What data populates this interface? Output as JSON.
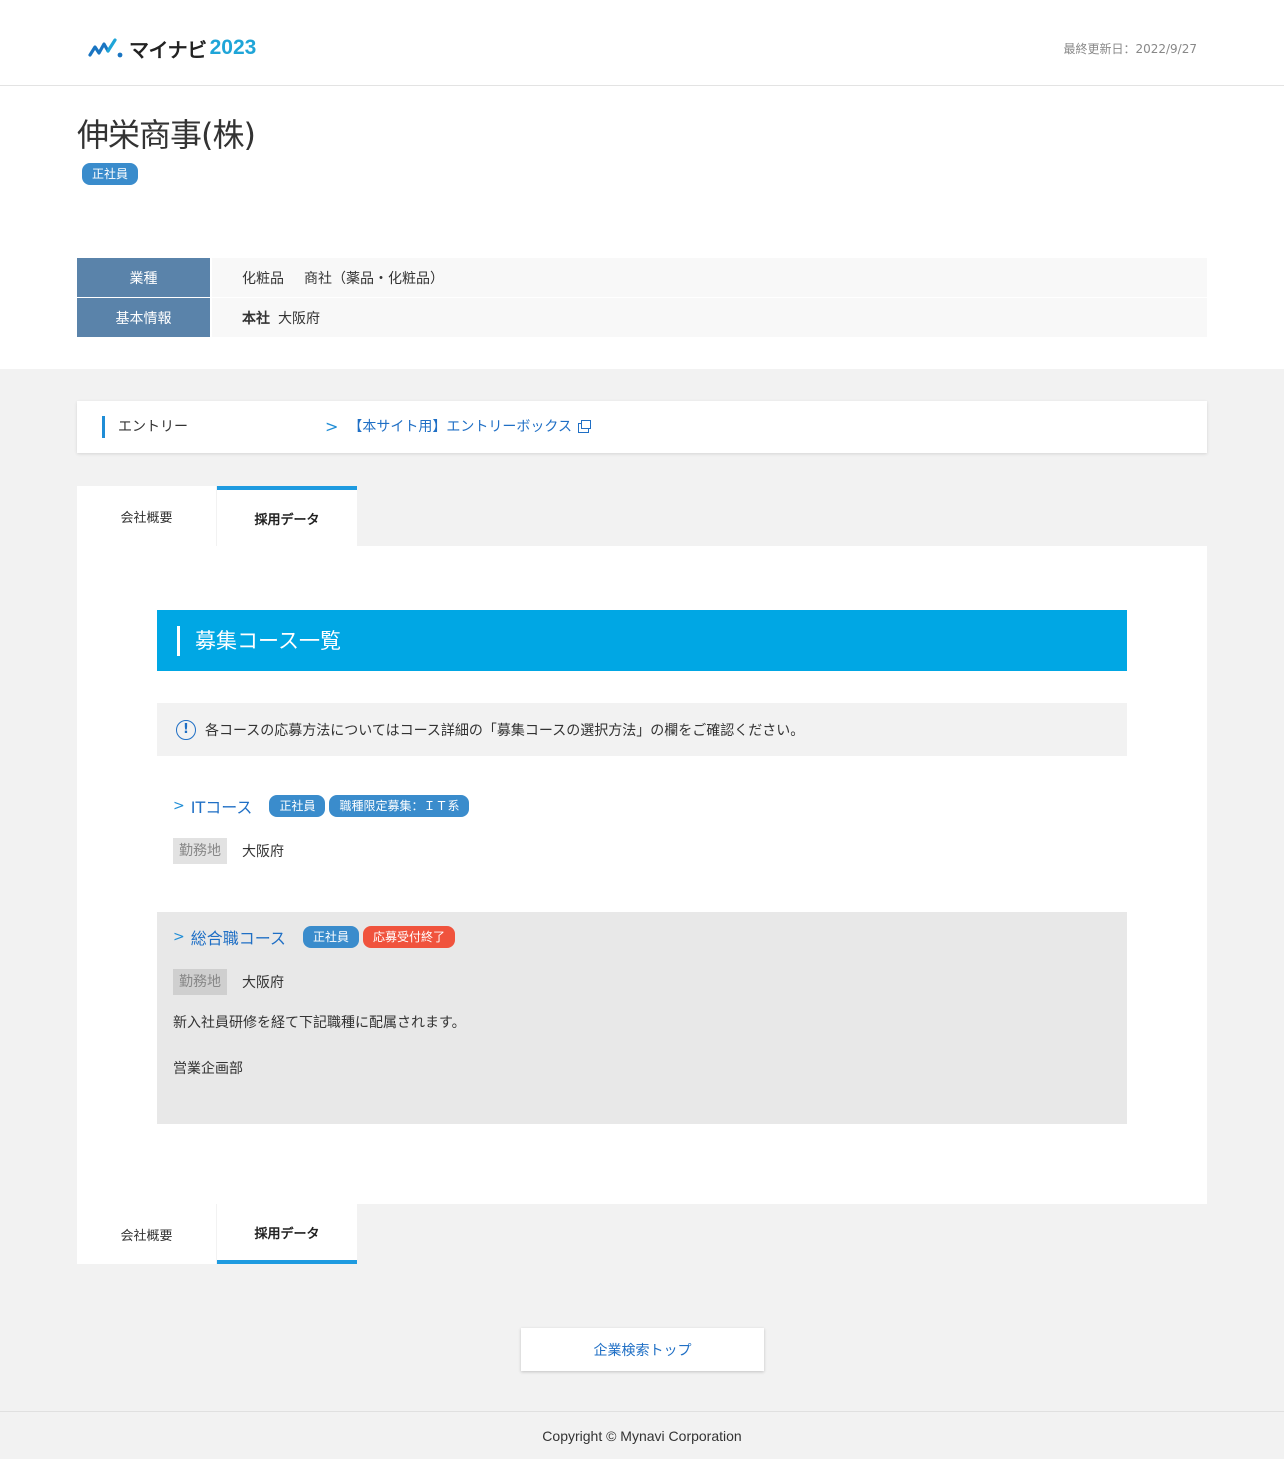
{
  "header": {
    "logo_text": "マイナビ",
    "logo_year": "2023",
    "updated": "最終更新日：2022/9/27"
  },
  "company": {
    "name": "伸栄商事(株)",
    "badge": "正社員",
    "info": {
      "industry_label": "業種",
      "industry_value_1": "化粧品",
      "industry_value_2": "商社（薬品・化粧品）",
      "basic_label": "基本情報",
      "hq_label": "本社",
      "hq_value": "大阪府"
    }
  },
  "entry": {
    "label": "エントリー",
    "link": "【本サイト用】エントリーボックス"
  },
  "tabs": {
    "overview": "会社概要",
    "recruit": "採用データ"
  },
  "section": {
    "title": "募集コース一覧",
    "notice": "各コースの応募方法についてはコース詳細の「募集コースの選択方法」の欄をご確認ください。"
  },
  "courses": [
    {
      "name": "ITコース",
      "badges": [
        "正社員",
        "職種限定募集：ＩＴ系"
      ],
      "location_label": "勤務地",
      "location": "大阪府"
    },
    {
      "name": "総合職コース",
      "badges": [
        "正社員",
        "応募受付終了"
      ],
      "location_label": "勤務地",
      "location": "大阪府",
      "desc_1": "新入社員研修を経て下記職種に配属されます。",
      "desc_2": "営業企画部"
    }
  ],
  "buttons": {
    "search_top": "企業検索トップ"
  },
  "footer": {
    "copyright": "Copyright © Mynavi Corporation"
  },
  "colors": {
    "accent": "#00a7e4",
    "badge_blue": "#3a8ccc",
    "badge_red": "#f0533d",
    "table_head": "#5a83aa",
    "link": "#1f6fc5"
  }
}
